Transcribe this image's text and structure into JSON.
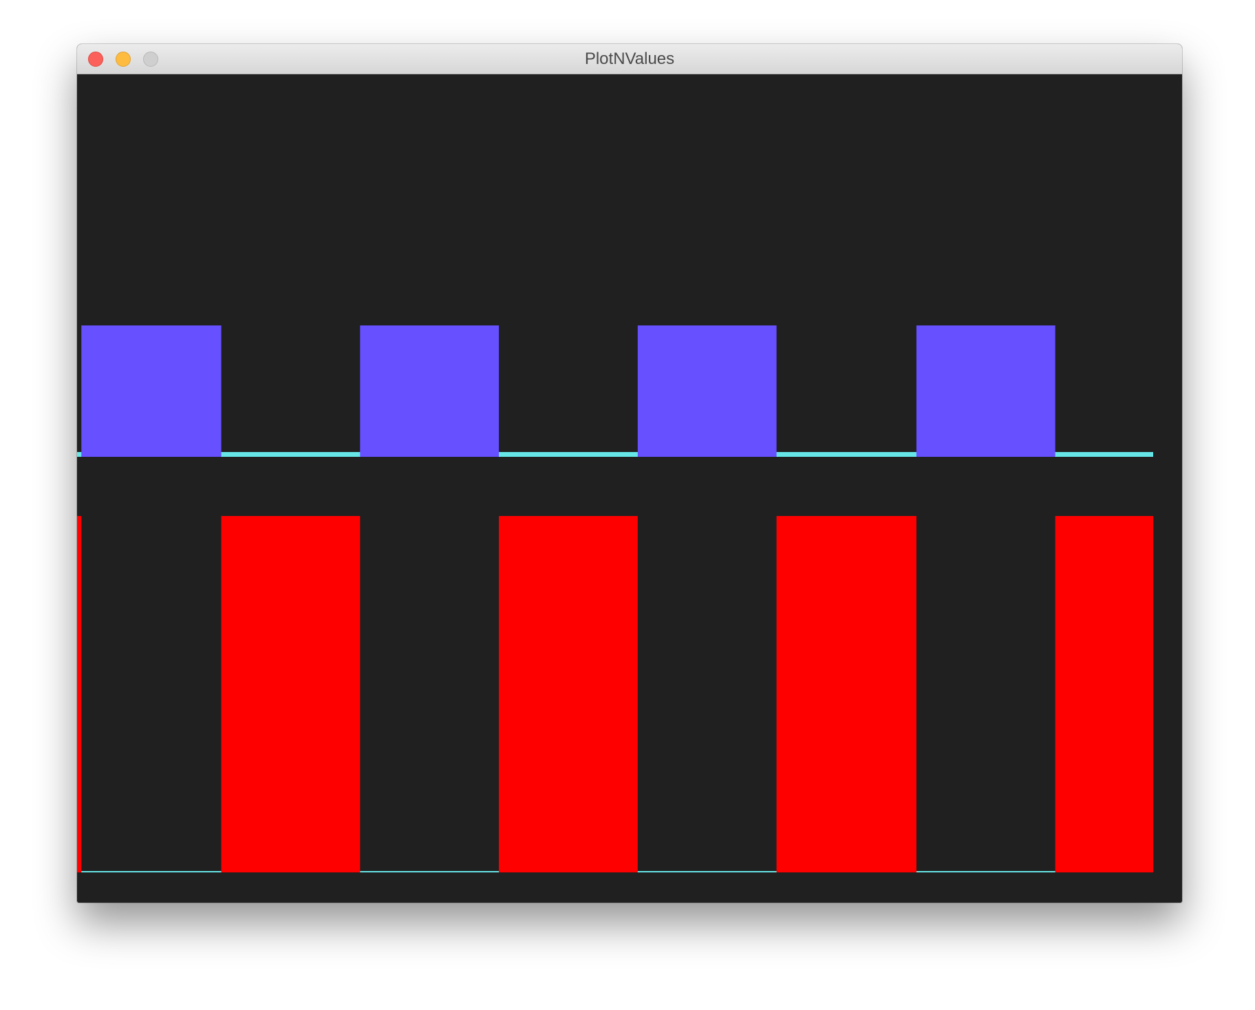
{
  "window": {
    "title": "PlotNValues"
  },
  "colors": {
    "background": "#202020",
    "square_wave_a": "#6650ff",
    "square_wave_b": "#ff0000",
    "baseline": "#66e6e6"
  },
  "chart_data": [
    {
      "type": "area",
      "title": "",
      "xlabel": "",
      "ylabel": "",
      "grid": false,
      "legend": "none",
      "xlim": [
        0,
        1
      ],
      "ylim": [
        0,
        1
      ],
      "series": [
        {
          "color": "#6650ff",
          "baseline_color": "#66e6e6",
          "x": [
            0.0,
            0.004,
            0.134,
            0.263,
            0.392,
            0.521,
            0.65,
            0.78,
            0.909,
            1.0
          ],
          "y": [
            0,
            1,
            0,
            1,
            0,
            1,
            0,
            1,
            0,
            0
          ]
        }
      ]
    },
    {
      "type": "area",
      "title": "",
      "xlabel": "",
      "ylabel": "",
      "grid": false,
      "legend": "none",
      "xlim": [
        0,
        1
      ],
      "ylim": [
        0,
        1
      ],
      "series": [
        {
          "color": "#ff0000",
          "baseline_color": "#66e6e6",
          "x": [
            0.0,
            0.004,
            0.134,
            0.263,
            0.392,
            0.521,
            0.65,
            0.78,
            0.909,
            1.0
          ],
          "y": [
            1,
            0,
            1,
            0,
            1,
            0,
            1,
            0,
            1,
            1
          ]
        }
      ]
    }
  ]
}
